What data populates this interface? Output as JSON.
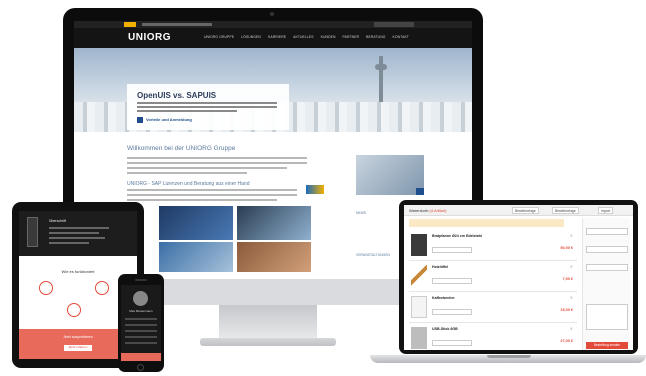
{
  "imac_site": {
    "logo": "UNIORG",
    "nav": [
      "UNIORG GRUPPE",
      "LÖSUNGEN",
      "KARRIERE",
      "AKTUELLES",
      "KUNDEN",
      "PARTNER",
      "BERATUNG",
      "KONTAKT"
    ],
    "hero_title": "OpenUIS vs. SAPUIS",
    "hero_button": "Vorteile und Anmeldung",
    "welcome": "Willkommen bei der UNIORG Gruppe",
    "subheading": "UNIORG - SAP Lizenzen und Beratung aus einer Hand",
    "news_label": "NEWS",
    "events_label": "VERANSTALTUNGEN"
  },
  "laptop_cart": {
    "title": "Warenkorb",
    "title_count": "(4 Artikel)",
    "buttons": [
      "Bestellvorlage",
      "Bestellvorlage",
      "Import"
    ],
    "items": [
      {
        "name": "Bratpfanne Ø24 cm Edelstahl",
        "price": "50,00 €"
      },
      {
        "name": "Holzlöffel",
        "price": "7,50 €"
      },
      {
        "name": "Kaffeebecher",
        "price": "15,00 €"
      },
      {
        "name": "USB-Stick 8GB",
        "price": "27,00 €"
      }
    ],
    "order_button": "Bestellung senden"
  },
  "tablet": {
    "headline": "Überschrift",
    "middle_heading": "Wie es funktioniert",
    "footer_text": "Jetzt ausprobieren",
    "footer_button": "Mehr erfahren"
  },
  "phone": {
    "name": "Max Mustermann",
    "button": "Abmelden"
  }
}
